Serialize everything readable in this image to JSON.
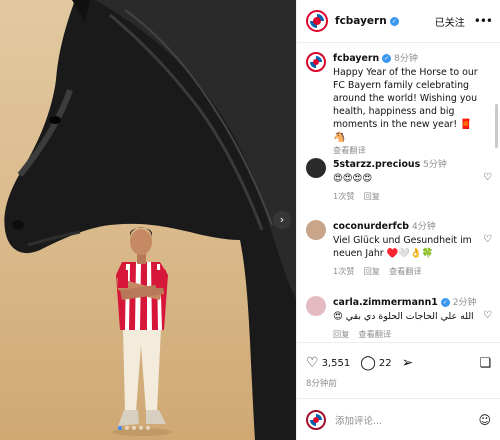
{
  "post": {
    "username": "fcbayern",
    "follow_status": "已关注",
    "verified_icon": "verified-badge-icon",
    "more_icon": "more-horizontal-icon"
  },
  "caption": {
    "username": "fcbayern",
    "time": "8分钟",
    "text": "Happy Year of the Horse to our FC Bayern family celebrating around the world! Wishing you health, happiness and big moments in the new year! 🧧",
    "emoji": "🐴",
    "see_translation": "查看翻译"
  },
  "comments": [
    {
      "username": "5starzz.precious",
      "time": "5分钟",
      "text": "😍😍😍😍",
      "likes": "1次赞",
      "reply": "回复"
    },
    {
      "username": "coconurderfcb",
      "time": "4分钟",
      "text": "Viel Glück und Gesundheit im neuen Jahr ♥️🤍👌🍀",
      "likes": "1次赞",
      "reply": "回复",
      "see_translation": "查看翻译"
    },
    {
      "username": "carla.zimmermann1",
      "time": "2分钟",
      "text": "😍 الله علي الحاجات الحلوة دي بقي",
      "reply": "回复",
      "see_translation": "查看翻译"
    }
  ],
  "actions": {
    "likes": "3,551",
    "comments": "22",
    "post_time": "8分钟前"
  },
  "comment_bar": {
    "placeholder": "添加评论...",
    "emoji_icon": "smiley-icon"
  },
  "carousel": {
    "slides": 5,
    "active_slide": 1
  }
}
